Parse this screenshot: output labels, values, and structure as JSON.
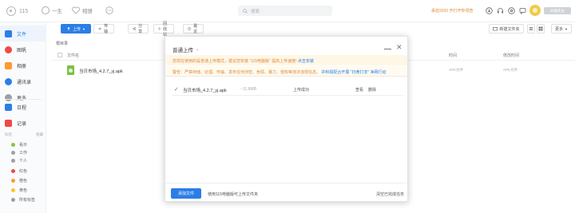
{
  "header": {
    "logo": "115",
    "nav": [
      {
        "label": "一生"
      },
      {
        "label": "相册"
      }
    ],
    "search_placeholder": "搜索",
    "promo": "承担2020 开打开你领查",
    "user": "约翰先生"
  },
  "sidebar": {
    "items": [
      {
        "label": "文件"
      },
      {
        "label": "图帆"
      },
      {
        "label": "相册"
      },
      {
        "label": "通讯录"
      },
      {
        "label": "更多"
      },
      {
        "label": "日程"
      },
      {
        "label": "记录"
      }
    ],
    "tags_title": "标签",
    "tags_manage": "隐藏",
    "tags": [
      {
        "label": "看示",
        "color": "#8bc34a"
      },
      {
        "label": "工作",
        "color": "#9aa0a6"
      },
      {
        "label": "个人",
        "color": "#9aa0a6"
      },
      {
        "label": "红色",
        "color": "#f04848"
      },
      {
        "label": "橙色",
        "color": "#ff9a2e"
      },
      {
        "label": "黄色",
        "color": "#f5c723"
      },
      {
        "label": "所有标签",
        "color": "#9aa0a6"
      }
    ]
  },
  "toolbar": {
    "upload": "上传",
    "buttons": [
      {
        "label": "传输"
      },
      {
        "label": "分享"
      },
      {
        "label": "回收站"
      },
      {
        "label": "最近"
      }
    ],
    "new_folder": "新建文件夹",
    "more": "更多"
  },
  "breadcrumb": "根目录",
  "list": {
    "columns": [
      "文件名",
      "时间",
      "修改时间"
    ],
    "rows": [
      {
        "name": "当贝市场_4.2.7_yj.apk",
        "size": "APK文件",
        "date": "APK文件"
      }
    ]
  },
  "modal": {
    "title": "普通上传",
    "note1_text": "您现在使用的是普通上传模式，建议您安装 “115电脑版” 提高上传速度!",
    "note1_link": "点击安装",
    "note2_text": "警告：严禁存储、处理、传输、发布任何涉密、色情、暴力、侵权等违法违规信息。",
    "note2_link": "并积极配合开展 “扫黄打非” 净网行动",
    "rows": [
      {
        "name": "当贝市场_4.2.7_yj.apk",
        "size": "- 11.6MB",
        "status": "上传成功",
        "action1": "查看",
        "action2": "删除"
      }
    ],
    "add_button": "添加文件",
    "tip": "使用115电脑版可上传文件夹",
    "clear": "清空已完成任务"
  }
}
